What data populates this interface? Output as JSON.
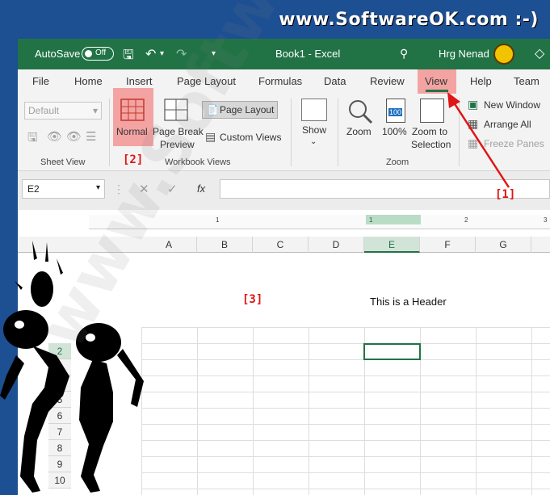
{
  "brand": {
    "text": "www.SoftwareOK.com :-)"
  },
  "titlebar": {
    "autosave_label": "AutoSave",
    "autosave_state": "Off",
    "doc_title": "Book1  -  Excel",
    "user": "Hrg Nenad"
  },
  "tabs": [
    "File",
    "Home",
    "Insert",
    "Page Layout",
    "Formulas",
    "Data",
    "Review",
    "View",
    "Help",
    "Team"
  ],
  "ribbon": {
    "sheet_view": {
      "dropdown": "Default",
      "label": "Sheet View"
    },
    "workbook_views": {
      "normal": "Normal",
      "page_break_1": "Page Break",
      "page_break_2": "Preview",
      "page_layout": "Page Layout",
      "custom_views": "Custom Views",
      "label": "Workbook Views"
    },
    "show": {
      "label": "Show"
    },
    "zoom": {
      "zoom": "Zoom",
      "percent": "100%",
      "zoom_sel_1": "Zoom to",
      "zoom_sel_2": "Selection",
      "label": "Zoom"
    },
    "window": {
      "new_window": "New Window",
      "arrange_all": "Arrange All",
      "freeze_panes": "Freeze Panes"
    }
  },
  "formula_bar": {
    "name_box": "E2",
    "fx": "fx"
  },
  "ruler": {
    "ticks": [
      "1",
      "1",
      "2",
      "3"
    ]
  },
  "sheet": {
    "columns": [
      "A",
      "B",
      "C",
      "D",
      "E",
      "F",
      "G"
    ],
    "rows": [
      "2",
      "3",
      "4",
      "5",
      "6",
      "7",
      "8",
      "9",
      "10"
    ],
    "header_text": "This is a Header"
  },
  "annotations": {
    "m1": "[1]",
    "m2": "[2]",
    "m3": "[3]"
  },
  "colors": {
    "frame": "#1d4f93",
    "excel_green": "#217346",
    "highlight": "#f4a3a3",
    "marker_red": "#e01515"
  }
}
